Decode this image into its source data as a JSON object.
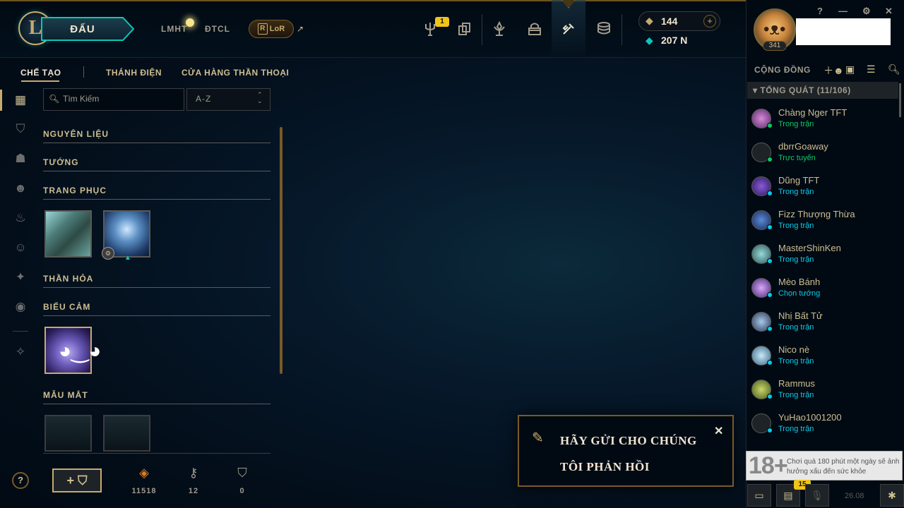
{
  "nav": {
    "logo_letter": "L",
    "play_label": "ĐẤU",
    "game_links": [
      "LMHT",
      "ĐTCL"
    ],
    "lor_label": "LoR",
    "lor_box": "R",
    "external_arrow": "↗",
    "badge_count": "1",
    "icons": [
      "trident-icon",
      "cards-icon",
      "trophy-icon",
      "backpack-icon",
      "crafting-icon",
      "store-coins-icon"
    ]
  },
  "currency": {
    "rp": "144",
    "be": "207 N",
    "plus": "+"
  },
  "profile": {
    "level": "341",
    "window_buttons": [
      "?",
      "—",
      "⚙",
      "✕"
    ]
  },
  "subtabs": {
    "crafting": "CHẾ TẠO",
    "sanctum": "THÁNH ĐIỆN",
    "mythic_shop": "CỬA HÀNG THẦN THOẠI"
  },
  "search": {
    "placeholder": "Tìm Kiếm",
    "sort": "A-Z"
  },
  "categories": {
    "materials": "NGUYÊN LIỆU",
    "champions": "TƯỚNG",
    "skins": "TRANG PHỤC",
    "eternals": "THẦN HỎA",
    "emotes": "BIỂU CẢM",
    "wards": "MẪU MẮT"
  },
  "loot_bar": {
    "add_label": "+ ⛉",
    "orange_essence": "11518",
    "keys": "12",
    "ward_tokens": "0"
  },
  "feedback": {
    "text": "HÃY GỬI CHO CHÚNG TÔI PHẢN HỒI",
    "close": "✕"
  },
  "social": {
    "title": "CỘNG ĐỒNG",
    "group": "TỔNG QUÁT (11/106)",
    "friends": [
      {
        "name": "Chàng Nger TFT",
        "status": "Trong trận",
        "state": "online"
      },
      {
        "name": "dbrrGoaway",
        "status": "Trực tuyến",
        "state": "online"
      },
      {
        "name": "Dũng TFT",
        "status": "Trong trận",
        "state": "ingame"
      },
      {
        "name": "Fizz Thượng Thừa",
        "status": "Trong trận",
        "state": "ingame"
      },
      {
        "name": "MasterShinKen",
        "status": "Trong trận",
        "state": "ingame"
      },
      {
        "name": "Mèo Bánh",
        "status": "Chọn tướng",
        "state": "ingame"
      },
      {
        "name": "Nhị Bất Tử",
        "status": "Trong trận",
        "state": "ingame"
      },
      {
        "name": "Nico nè",
        "status": "Trong trận",
        "state": "ingame"
      },
      {
        "name": "Rammus",
        "status": "Trong trận",
        "state": "ingame"
      },
      {
        "name": "YuHao1001200",
        "status": "Trong trận",
        "state": "ingame"
      }
    ]
  },
  "warning": {
    "age": "18+",
    "text": "Chơi quá 180 phút một ngày sẽ ảnh hưởng xấu đến sức khỏe"
  },
  "bottom_bar": {
    "badge": "15",
    "time": "26.08"
  },
  "colors": {
    "gold": "#c8aa6e",
    "teal": "#0ac8b9",
    "ingame_blue": "#0acbe6",
    "online_green": "#0ac864",
    "background": "#010a13"
  }
}
